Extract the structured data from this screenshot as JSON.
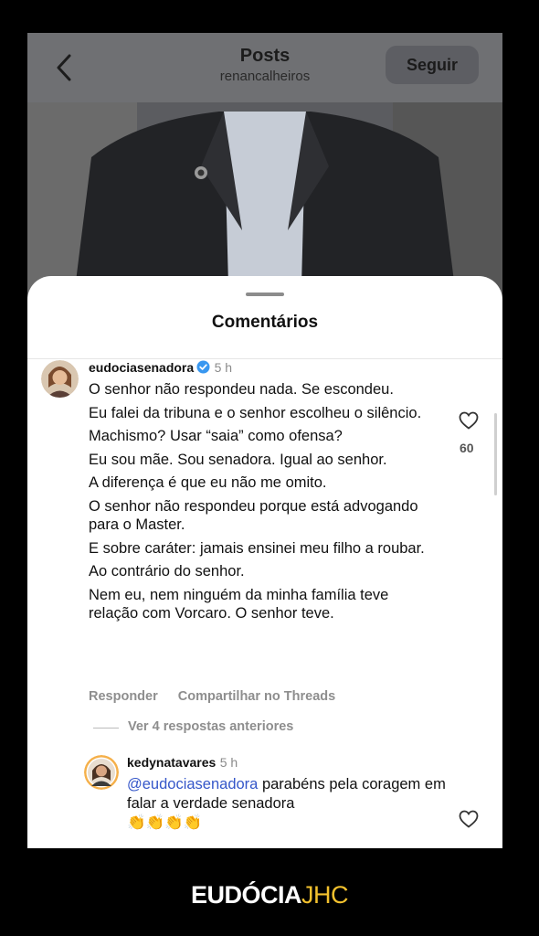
{
  "header": {
    "title": "Posts",
    "username": "renancalheiros",
    "follow_label": "Seguir"
  },
  "sheet": {
    "title": "Comentários"
  },
  "comment": {
    "username": "eudociasenadora",
    "time": "5 h",
    "verified": true,
    "paragraphs": [
      "O senhor não respondeu nada. Se escondeu.",
      "Eu falei da tribuna e o senhor escolheu o silêncio.",
      "Machismo? Usar “saia” como ofensa?",
      "Eu sou mãe. Sou senadora. Igual ao senhor.",
      "A diferença é que eu não me omito.",
      "O senhor não respondeu porque está advogando para o Master.",
      "E sobre caráter: jamais ensinei meu filho a roubar.",
      "Ao contrário do senhor.",
      "Nem eu, nem ninguém da minha família teve relação com Vorcaro. O senhor teve."
    ],
    "likes": "60",
    "reply_label": "Responder",
    "share_label": "Compartilhar no Threads",
    "view_replies": "Ver 4 respostas anteriores"
  },
  "reply": {
    "username": "kedynatavares",
    "time": "5 h",
    "mention": "@eudociasenadora",
    "text": " parabéns pela coragem em falar a verdade senadora",
    "emoji": "👏👏👏👏"
  },
  "brand": {
    "part1": "EUDÓCIA",
    "part2": "JHC"
  },
  "colors": {
    "accent_blue": "#3557c9",
    "brand_yellow": "#f2c12e",
    "verified_blue": "#3897f0"
  }
}
